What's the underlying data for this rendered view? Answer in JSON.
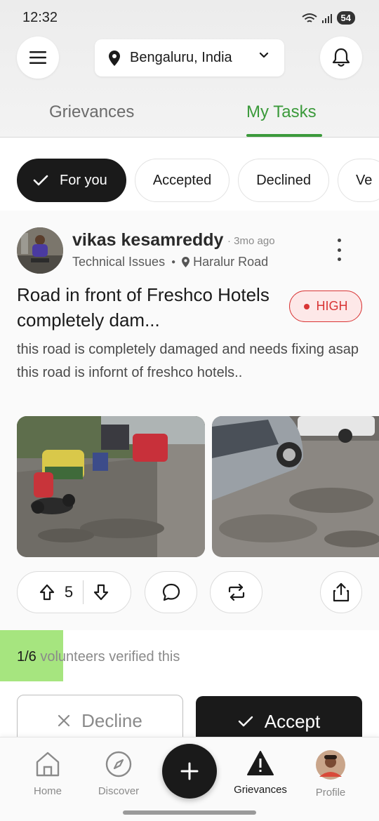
{
  "status_bar": {
    "time": "12:32",
    "battery": "54"
  },
  "header": {
    "location": "Bengaluru, India"
  },
  "tabs": [
    {
      "label": "Grievances",
      "active": false
    },
    {
      "label": "My Tasks",
      "active": true
    }
  ],
  "filters": [
    {
      "label": "For you",
      "active": true
    },
    {
      "label": "Accepted",
      "active": false
    },
    {
      "label": "Declined",
      "active": false
    },
    {
      "label": "Ve",
      "active": false
    }
  ],
  "post": {
    "author": "vikas kesamreddy",
    "time_ago": "· 3mo ago",
    "category": "Technical Issues",
    "place": "Haralur Road",
    "title": "Road in front of Freshco Hotels completely dam...",
    "priority": "HIGH",
    "description_line1": "this road is completely damaged and needs fixing asap",
    "description_line2": "this road is infornt of freshco hotels..",
    "votes": "5",
    "verified_count": "1/6",
    "verified_text": " volunteers verified this",
    "verified_fraction": 0.1667
  },
  "actions": {
    "decline": "Decline",
    "accept": "Accept"
  },
  "bottom_nav": [
    {
      "label": "Home",
      "icon": "home-icon"
    },
    {
      "label": "Discover",
      "icon": "compass-icon"
    },
    {
      "label": "Grievances",
      "icon": "warning-icon",
      "active": true
    },
    {
      "label": "Profile",
      "icon": "profile-avatar"
    }
  ],
  "colors": {
    "accent_green": "#3b9a3b",
    "priority_red": "#d93535",
    "dark": "#1a1a1a",
    "verified_fill": "#a6e57f"
  }
}
